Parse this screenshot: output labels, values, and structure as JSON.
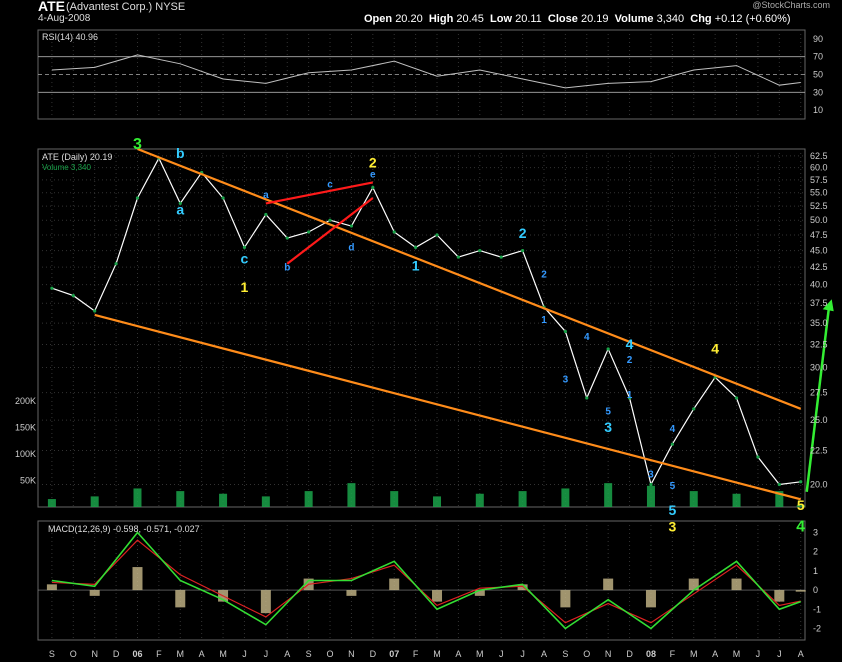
{
  "header": {
    "ticker": "ATE",
    "company": "(Advantest Corp.) NYSE",
    "date": "4-Aug-2008",
    "open_label": "Open",
    "open": "20.20",
    "high_label": "High",
    "high": "20.45",
    "low_label": "Low",
    "low": "20.11",
    "close_label": "Close",
    "close": "20.19",
    "volume_label": "Volume",
    "volume": "3,340",
    "chg_label": "Chg",
    "chg": "+0.12 (+0.60%)",
    "watermark": "@StockCharts.com"
  },
  "colors": {
    "background": "#000000",
    "price": "#ffffff",
    "volume": "#1aa34a",
    "trendline": "#ff8c1a",
    "channel": "#ff1a1a",
    "rsi": "#c0c0c0",
    "macd": "#33dd33",
    "signal": "#dd2222",
    "histogram": "#c8b98a",
    "projection_arrow": "#33ee33"
  },
  "chart_data": [
    {
      "type": "line",
      "panel": "rsi",
      "label": "RSI(14) 40.96",
      "ylim": [
        0,
        100
      ],
      "y_ticks": [
        10,
        30,
        50,
        70,
        90
      ],
      "reference_lines": [
        30,
        50,
        70
      ],
      "x": [
        "2005-09",
        "2005-11",
        "2006-01",
        "2006-03",
        "2006-05",
        "2006-07",
        "2006-09",
        "2006-11",
        "2007-01",
        "2007-03",
        "2007-05",
        "2007-07",
        "2007-09",
        "2007-11",
        "2008-01",
        "2008-03",
        "2008-05",
        "2008-07",
        "2008-08"
      ],
      "values": [
        55,
        58,
        72,
        62,
        45,
        40,
        52,
        55,
        65,
        48,
        55,
        45,
        35,
        40,
        42,
        55,
        60,
        38,
        41
      ]
    },
    {
      "type": "line",
      "panel": "price",
      "label": "ATE (Daily) 20.19",
      "scale": "log",
      "ylim": [
        18.5,
        64
      ],
      "y_ticks": [
        20.0,
        22.5,
        25.0,
        27.5,
        30.0,
        32.5,
        35.0,
        37.5,
        40.0,
        42.5,
        45.0,
        47.5,
        50.0,
        52.5,
        55.0,
        57.5,
        60.0,
        62.5
      ],
      "x_ticks": [
        "S",
        "O",
        "N",
        "D",
        "06",
        "F",
        "M",
        "A",
        "M",
        "J",
        "J",
        "A",
        "S",
        "O",
        "N",
        "D",
        "07",
        "F",
        "M",
        "A",
        "M",
        "J",
        "J",
        "A",
        "S",
        "O",
        "N",
        "D",
        "08",
        "F",
        "M",
        "A",
        "M",
        "J",
        "J",
        "A"
      ],
      "x": [
        "2005-09",
        "2005-10",
        "2005-11",
        "2005-12",
        "2006-01",
        "2006-02",
        "2006-03",
        "2006-04",
        "2006-05",
        "2006-06",
        "2006-07",
        "2006-08",
        "2006-09",
        "2006-10",
        "2006-11",
        "2006-12",
        "2007-01",
        "2007-02",
        "2007-03",
        "2007-04",
        "2007-05",
        "2007-06",
        "2007-07",
        "2007-08",
        "2007-09",
        "2007-10",
        "2007-11",
        "2007-12",
        "2008-01",
        "2008-02",
        "2008-03",
        "2008-04",
        "2008-05",
        "2008-06",
        "2008-07",
        "2008-08"
      ],
      "values": [
        39.5,
        38.5,
        36.5,
        43,
        54,
        62,
        53,
        59,
        54,
        45.5,
        51,
        47,
        48,
        50,
        49,
        56,
        48,
        45.5,
        47.5,
        44,
        45,
        44,
        45,
        37,
        34,
        27,
        32,
        27,
        20,
        23,
        26,
        29,
        27,
        22,
        20,
        20.19
      ]
    },
    {
      "type": "bar",
      "panel": "volume",
      "label": "Volume 3,340",
      "y_ticks": [
        "50K",
        "100K",
        "150K",
        "200K"
      ],
      "x": [
        "2005-09",
        "2005-11",
        "2006-01",
        "2006-03",
        "2006-05",
        "2006-07",
        "2006-09",
        "2006-11",
        "2007-01",
        "2007-03",
        "2007-05",
        "2007-07",
        "2007-09",
        "2007-11",
        "2008-01",
        "2008-03",
        "2008-05",
        "2008-07",
        "2008-08"
      ],
      "values": [
        15000,
        20000,
        35000,
        30000,
        25000,
        20000,
        30000,
        45000,
        30000,
        20000,
        25000,
        30000,
        35000,
        45000,
        40000,
        30000,
        25000,
        30000,
        3340
      ]
    },
    {
      "type": "line",
      "panel": "macd",
      "label": "MACD(12,26,9)",
      "values_label": "-0.598, -0.571, -0.027",
      "ylim": [
        -2.6,
        3.6
      ],
      "y_ticks": [
        3,
        2,
        1,
        0,
        -1,
        -2
      ],
      "x": [
        "2005-09",
        "2005-11",
        "2006-01",
        "2006-03",
        "2006-05",
        "2006-07",
        "2006-09",
        "2006-11",
        "2007-01",
        "2007-03",
        "2007-05",
        "2007-07",
        "2007-09",
        "2007-11",
        "2008-01",
        "2008-03",
        "2008-05",
        "2008-07",
        "2008-08"
      ],
      "series": [
        {
          "values": [
            0.5,
            0.2,
            3.0,
            0.5,
            -0.5,
            -1.8,
            0.5,
            0.5,
            1.5,
            -1.0,
            0.0,
            0.3,
            -2.0,
            -0.5,
            -2.0,
            0.0,
            1.5,
            -1.0,
            -0.598
          ]
        },
        {
          "values": [
            0.4,
            0.3,
            2.6,
            0.8,
            -0.3,
            -1.4,
            0.3,
            0.6,
            1.3,
            -0.8,
            0.1,
            0.2,
            -1.7,
            -0.7,
            -1.7,
            -0.2,
            1.3,
            -0.8,
            -0.571
          ]
        }
      ]
    }
  ],
  "annotations": [
    {
      "text": "3",
      "color": "#33ee33",
      "x": "2006-01",
      "price": 64
    },
    {
      "text": "b",
      "color": "#33ccff",
      "x": "2006-03",
      "price": 62
    },
    {
      "text": "a",
      "color": "#33ccff",
      "x": "2006-03",
      "price": 51
    },
    {
      "text": "c",
      "color": "#33ccff",
      "x": "2006-06",
      "price": 43
    },
    {
      "text": "1",
      "color": "#ffee33",
      "x": "2006-06",
      "price": 39
    },
    {
      "text": "a",
      "color": "#3399ff",
      "x": "2006-07",
      "price": 54
    },
    {
      "text": "b",
      "color": "#3399ff",
      "x": "2006-08",
      "price": 42
    },
    {
      "text": "c",
      "color": "#3399ff",
      "x": "2006-10",
      "price": 56
    },
    {
      "text": "d",
      "color": "#3399ff",
      "x": "2006-11",
      "price": 45
    },
    {
      "text": "e",
      "color": "#3399ff",
      "x": "2006-12",
      "price": 58
    },
    {
      "text": "2",
      "color": "#ffee33",
      "x": "2006-12",
      "price": 60
    },
    {
      "text": "1",
      "color": "#33ccff",
      "x": "2007-02",
      "price": 42
    },
    {
      "text": "2",
      "color": "#33ccff",
      "x": "2007-07",
      "price": 47
    },
    {
      "text": "2",
      "color": "#3399ff",
      "x": "2007-08",
      "price": 41
    },
    {
      "text": "1",
      "color": "#3399ff",
      "x": "2007-08",
      "price": 35
    },
    {
      "text": "3",
      "color": "#3399ff",
      "x": "2007-09",
      "price": 28.5
    },
    {
      "text": "4",
      "color": "#3399ff",
      "x": "2007-10",
      "price": 33
    },
    {
      "text": "5",
      "color": "#3399ff",
      "x": "2007-11",
      "price": 25.5
    },
    {
      "text": "3",
      "color": "#33ccff",
      "x": "2007-11",
      "price": 24
    },
    {
      "text": "4",
      "color": "#33ccff",
      "x": "2007-12",
      "price": 32
    },
    {
      "text": "2",
      "color": "#3399ff",
      "x": "2007-12",
      "price": 30.5
    },
    {
      "text": "1",
      "color": "#3399ff",
      "x": "2007-12",
      "price": 27
    },
    {
      "text": "4",
      "color": "#3399ff",
      "x": "2008-02",
      "price": 24
    },
    {
      "text": "3",
      "color": "#3399ff",
      "x": "2008-01",
      "price": 20.5
    },
    {
      "text": "5",
      "color": "#3399ff",
      "x": "2008-02",
      "price": 19.7
    },
    {
      "text": "4",
      "color": "#ffee33",
      "x": "2008-04",
      "price": 31.5
    },
    {
      "text": "5",
      "color": "#33ccff",
      "x": "2008-02",
      "price": 18
    },
    {
      "text": "3",
      "color": "#ffee33",
      "x": "2008-02",
      "price": 17
    },
    {
      "text": "5",
      "color": "#ffee33",
      "x": "2008-08",
      "price": 18.3
    },
    {
      "text": "4",
      "color": "#33ee33",
      "x": "2008-08",
      "price": 17
    }
  ]
}
